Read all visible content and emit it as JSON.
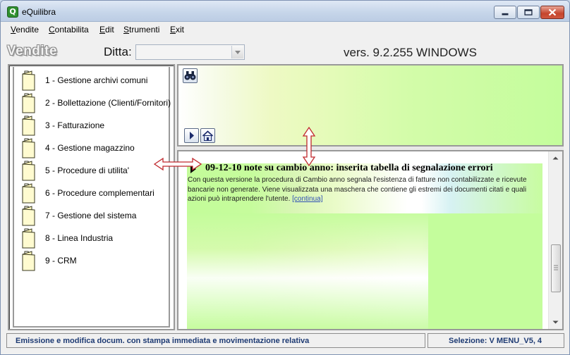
{
  "window": {
    "title": "eQuilibra",
    "icon": "app-logo-icon"
  },
  "menubar": {
    "items": [
      {
        "label": "Vendite"
      },
      {
        "label": "Contabilita"
      },
      {
        "label": "Edit"
      },
      {
        "label": "Strumenti"
      },
      {
        "label": "Exit"
      }
    ]
  },
  "toolbar": {
    "module_title": "Vendite",
    "ditta_label": "Ditta:",
    "ditta_value": "",
    "version": "vers. 9.2.255 WINDOWS"
  },
  "menu_tree": {
    "items": [
      {
        "label": "1 - Gestione archivi comuni",
        "icon": "folder-icon"
      },
      {
        "label": "2 - Bollettazione (Clienti/Fornitori)",
        "icon": "folder-icon"
      },
      {
        "label": "3 - Fatturazione",
        "icon": "folder-icon"
      },
      {
        "label": "4 - Gestione magazzino",
        "icon": "folder-icon"
      },
      {
        "label": "5 - Procedure di utilita'",
        "icon": "folder-icon"
      },
      {
        "label": "6 - Procedure complementari",
        "icon": "folder-icon"
      },
      {
        "label": "7 - Gestione del sistema",
        "icon": "folder-icon"
      },
      {
        "label": "8 - Linea Industria",
        "icon": "folder-icon"
      },
      {
        "label": "9 - CRM",
        "icon": "folder-icon"
      }
    ]
  },
  "news": {
    "heading": "09-12-10 note su cambio anno: inserita tabella di segnalazione errori",
    "body": "Con questa versione la procedura di Cambio anno segnala l'esistenza di fatture non contabilizzate e ricevute bancarie non generate. Viene visualizzata una maschera che contiene gli estremi dei documenti citati e quali azioni può intraprendere l'utente.",
    "link": "[continua]"
  },
  "statusbar": {
    "message": "Emissione e modifica docum. con stampa immediata e movimentazione relativa",
    "selection": "Selezione: V MENU_V5, 4"
  },
  "colors": {
    "status_text": "#1d3a73",
    "resize_arrow": "#c0282d",
    "news_green": "#c4fd9c"
  }
}
